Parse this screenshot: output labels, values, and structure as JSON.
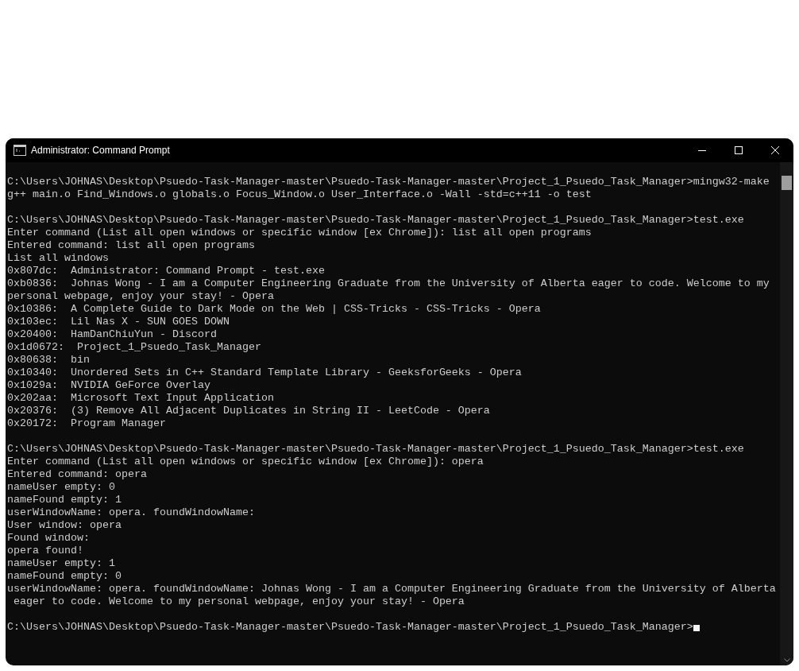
{
  "window": {
    "title": "Administrator: Command Prompt"
  },
  "console": {
    "blocks": [
      [
        "C:\\Users\\JOHNAS\\Desktop\\Psuedo-Task-Manager-master\\Psuedo-Task-Manager-master\\Project_1_Psuedo_Task_Manager>mingw32-make",
        "g++ main.o Find_Windows.o globals.o Focus_Window.o User_Interface.o -Wall -std=c++11 -o test"
      ],
      [
        "C:\\Users\\JOHNAS\\Desktop\\Psuedo-Task-Manager-master\\Psuedo-Task-Manager-master\\Project_1_Psuedo_Task_Manager>test.exe",
        "Enter command (List all open windows or specific window [ex Chrome]): list all open programs",
        "Entered command: list all open programs",
        "List all windows",
        "0x807dc:  Administrator: Command Prompt - test.exe",
        "0xb0836:  Johnas Wong - I am a Computer Engineering Graduate from the University of Alberta eager to code. Welcome to my",
        "personal webpage, enjoy your stay! - Opera",
        "0x10386:  A Complete Guide to Dark Mode on the Web | CSS-Tricks - CSS-Tricks - Opera",
        "0x103ec:  Lil Nas X - SUN GOES DOWN",
        "0x20400:  HamDanChiuYun - Discord",
        "0x1d0672:  Project_1_Psuedo_Task_Manager",
        "0x80638:  bin",
        "0x10340:  Unordered Sets in C++ Standard Template Library - GeeksforGeeks - Opera",
        "0x1029a:  NVIDIA GeForce Overlay",
        "0x202aa:  Microsoft Text Input Application",
        "0x20376:  (3) Remove All Adjacent Duplicates in String II - LeetCode - Opera",
        "0x20172:  Program Manager"
      ],
      [
        "C:\\Users\\JOHNAS\\Desktop\\Psuedo-Task-Manager-master\\Psuedo-Task-Manager-master\\Project_1_Psuedo_Task_Manager>test.exe",
        "Enter command (List all open windows or specific window [ex Chrome]): opera",
        "Entered command: opera",
        "nameUser empty: 0",
        "nameFound empty: 1",
        "userWindowName: opera. foundWindowName:",
        "User window: opera",
        "Found window:",
        "opera found!",
        "nameUser empty: 1",
        "nameFound empty: 0",
        "userWindowName: opera. foundWindowName: Johnas Wong - I am a Computer Engineering Graduate from the University of Alberta",
        " eager to code. Welcome to my personal webpage, enjoy your stay! - Opera"
      ]
    ],
    "prompt": "C:\\Users\\JOHNAS\\Desktop\\Psuedo-Task-Manager-master\\Psuedo-Task-Manager-master\\Project_1_Psuedo_Task_Manager>"
  }
}
